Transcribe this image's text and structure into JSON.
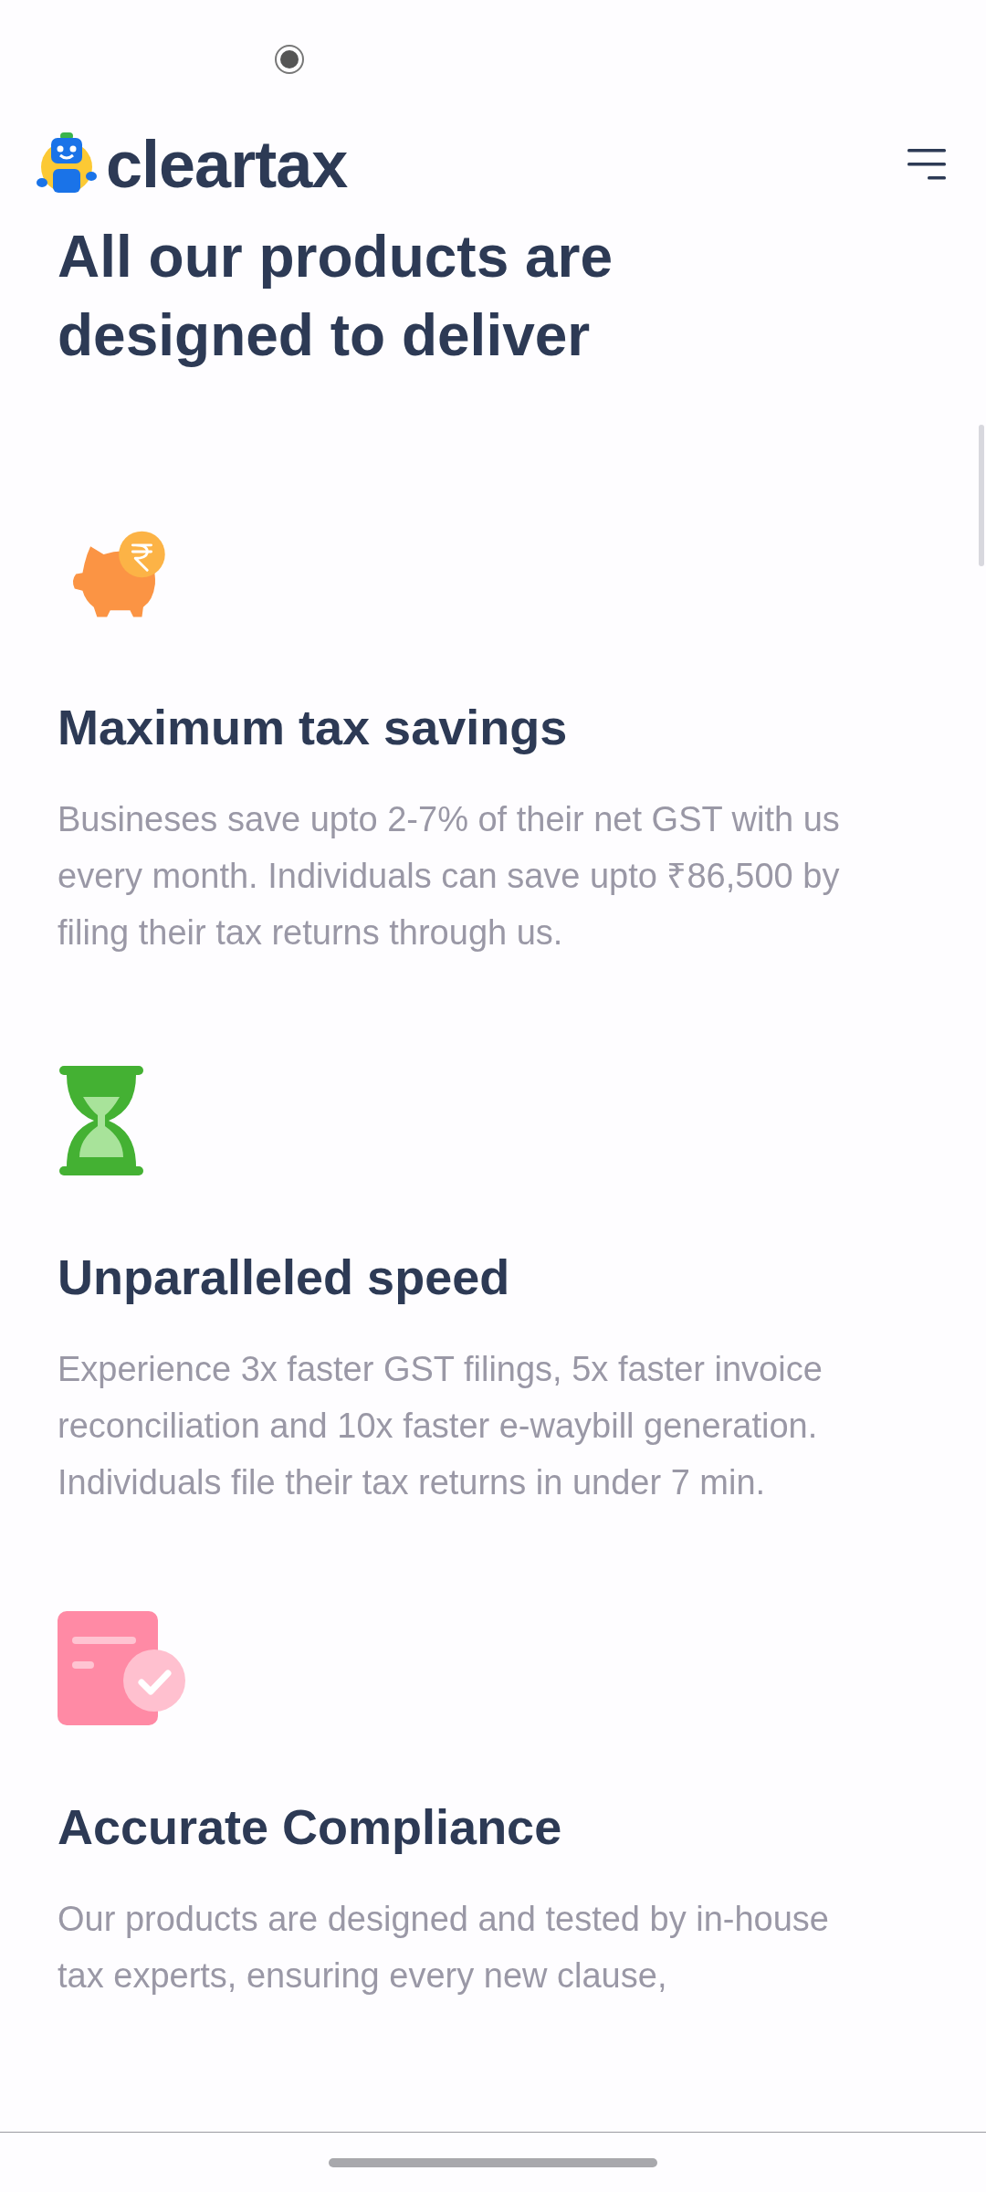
{
  "header": {
    "logo_text": "cleartax"
  },
  "heading": "All our products are designed to deliver",
  "features": [
    {
      "kind": "piggy",
      "title": "Maximum tax savings",
      "body": "Busineses save upto 2-7% of their net GST with us every month. Individuals can save upto ₹86,500 by filing their tax returns through us."
    },
    {
      "kind": "hourglass",
      "title": "Unparalleled speed",
      "body": "Experience 3x faster GST filings, 5x faster invoice reconciliation and 10x faster e-waybill generation. Individuals file their tax returns in under 7 min."
    },
    {
      "kind": "document-check",
      "title": "Accurate Compliance",
      "body": "Our products are designed and tested by in-house tax experts, ensuring every new clause,"
    }
  ]
}
